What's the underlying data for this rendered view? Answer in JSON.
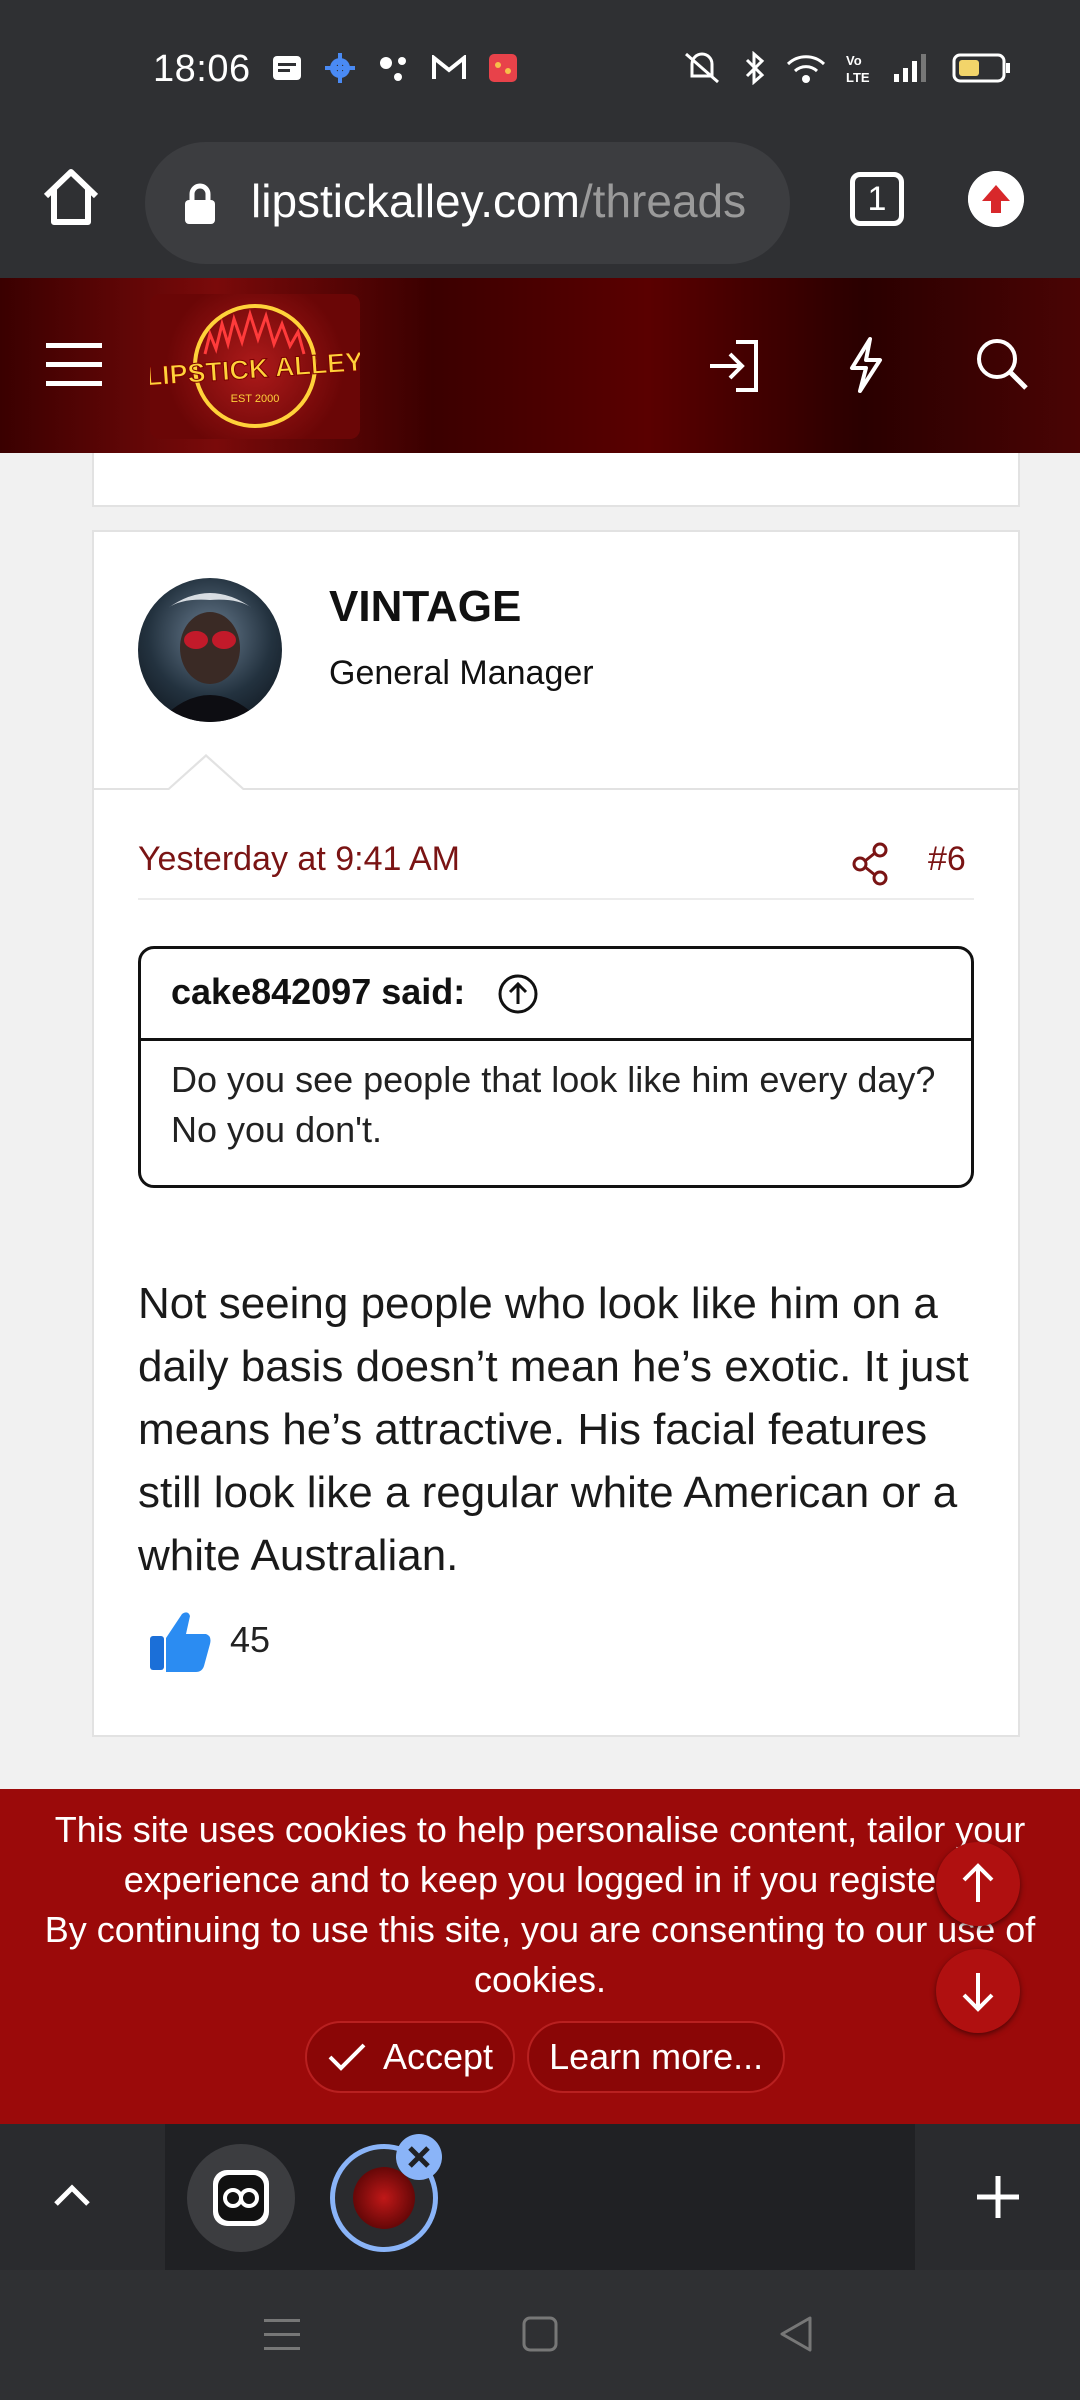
{
  "status_bar": {
    "time": "18:06"
  },
  "browser": {
    "url_domain": "lipstickalley.com",
    "url_path": "/threads",
    "tab_count": "1"
  },
  "site": {
    "logo_text": "LIPSTICK ALLEY",
    "logo_sub": "EST 2000"
  },
  "post": {
    "username": "VINTAGE",
    "user_title": "General Manager",
    "date": "Yesterday at 9:41 AM",
    "number": "#6",
    "quote_author": "cake842097 said:",
    "quote_text": "Do you see people that look like him every day? No you don't.",
    "body": "Not seeing people who look like him on a daily basis doesn’t mean he’s exotic. It just means he’s attractive. His facial features still look like a regular white American or a white Australian.",
    "reaction_count": "45"
  },
  "cookie_banner": {
    "line1": "This site uses cookies to help personalise content, tailor your experience and to keep you logged in if you register.",
    "line2": "By continuing to use this site, you are consenting to our use of cookies.",
    "accept_label": "Accept",
    "learn_more_label": "Learn more..."
  },
  "colors": {
    "brand_red": "#9b0a0a",
    "link_red": "#7a1414",
    "tab_highlight": "#8ab4f8"
  }
}
